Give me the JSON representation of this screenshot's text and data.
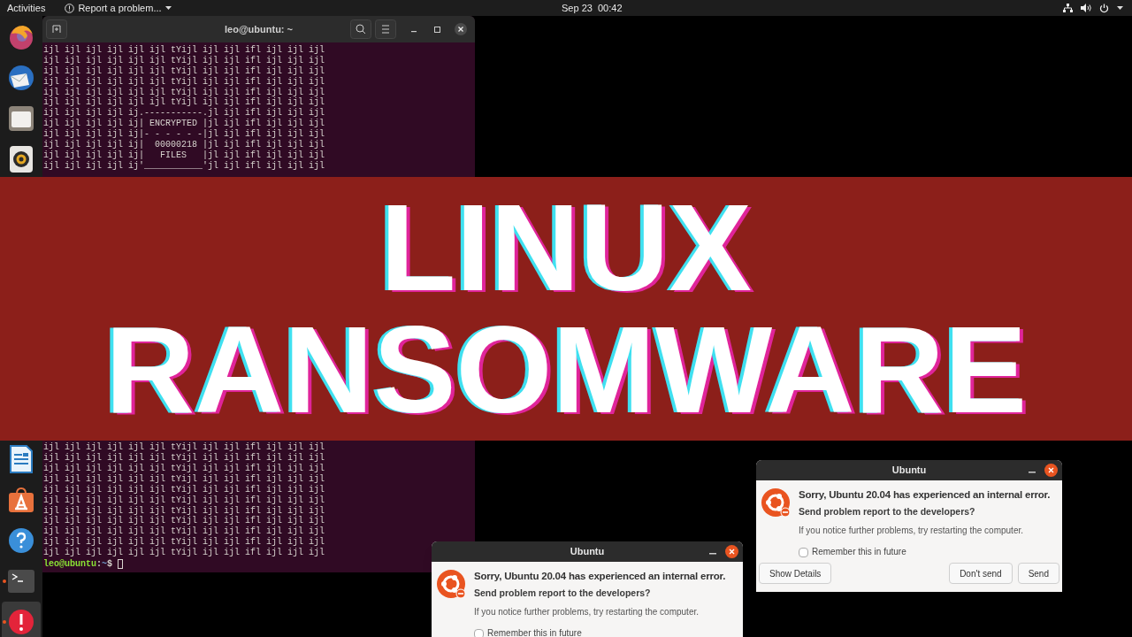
{
  "top_bar": {
    "activities": "Activities",
    "app_menu": "Report a problem...",
    "clock": "Sep 23  00:42"
  },
  "dock": {
    "items_top": [
      {
        "kind": "firefox",
        "running": false,
        "selected": false
      },
      {
        "kind": "mail",
        "running": false,
        "selected": false
      },
      {
        "kind": "files",
        "running": false,
        "selected": false
      },
      {
        "kind": "music",
        "running": false,
        "selected": false
      }
    ],
    "items_bottom": [
      {
        "kind": "writer",
        "running": false,
        "selected": false
      },
      {
        "kind": "store",
        "running": false,
        "selected": false
      },
      {
        "kind": "help",
        "running": false,
        "selected": false
      },
      {
        "kind": "terminal",
        "running": true,
        "selected": false
      },
      {
        "kind": "error",
        "running": true,
        "selected": true
      }
    ]
  },
  "terminal": {
    "title": "leo@ubuntu: ~",
    "lines_top": [
      "ijl ijl ijl ijl ijl ijl tYijl ijl ijl ifl ijl ijl ijl",
      "ijl ijl ijl ijl ijl ijl tYijl ijl ijl ifl ijl ijl ijl",
      "ijl ijl ijl ijl ijl ijl tYijl ijl ijl ifl ijl ijl ijl",
      "ijl ijl ijl ijl ijl ijl tYijl ijl ijl ifl ijl ijl ijl",
      "ijl ijl ijl ijl ijl ijl tYijl ijl ijl ifl ijl ijl ijl",
      "ijl ijl ijl ijl ijl ijl tYijl ijl ijl ifl ijl ijl ijl",
      "ijl ijl ijl ijl ij.-----------.jl ijl ifl ijl ijl ijl",
      "ijl ijl ijl ijl ij| ENCRYPTED |jl ijl ifl ijl ijl ijl",
      "ijl ijl ijl ijl ij|- - - - - -|jl ijl ifl ijl ijl ijl",
      "ijl ijl ijl ijl ij|  00000218 |jl ijl ifl ijl ijl ijl",
      "ijl ijl ijl ijl ij|   FILES   |jl ijl ifl ijl ijl ijl",
      "ijl ijl ijl ijl ij'___________'jl ijl ifl ijl ijl ijl"
    ],
    "lines_bottom": [
      "ijl ijl ijl ijl ijl ijl tYijl ijl ijl ifl ijl ijl ijl",
      "ijl ijl ijl ijl ijl ijl tYijl ijl ijl ifl ijl ijl ijl",
      "ijl ijl ijl ijl ijl ijl tYijl ijl ijl ifl ijl ijl ijl",
      "ijl ijl ijl ijl ijl ijl tYijl ijl ijl ifl ijl ijl ijl",
      "ijl ijl ijl ijl ijl ijl tYijl ijl ijl ifl ijl ijl ijl",
      "ijl ijl ijl ijl ijl ijl tYijl ijl ijl ifl ijl ijl ijl",
      "ijl ijl ijl ijl ijl ijl tYijl ijl ijl ifl ijl ijl ijl",
      "ijl ijl ijl ijl ijl ijl tYijl ijl ijl ifl ijl ijl ijl",
      "ijl ijl ijl ijl ijl ijl tYijl ijl ijl ifl ijl ijl ijl",
      "ijl ijl ijl ijl ijl ijl tYijl ijl ijl ifl ijl ijl ijl",
      "ijl ijl ijl ijl ijl ijl tYijl ijl ijl ifl ijl ijl ijl"
    ],
    "prompt": {
      "user_host": "leo@ubuntu",
      "separator": ":",
      "path": "~",
      "symbol": "$"
    }
  },
  "banner": {
    "lines": [
      "LINUX",
      "RANSOMWARE"
    ]
  },
  "dialogs": [
    {
      "title": "Ubuntu",
      "heading": "Sorry, Ubuntu 20.04 has experienced an internal error.",
      "question": "Send problem report to the developers?",
      "hint": "If you notice further problems, try restarting the computer.",
      "remember": {
        "label": "Remember this in future",
        "checked": false
      },
      "buttons": [
        "Show Details",
        "Don't send",
        "Send"
      ]
    },
    {
      "title": "Ubuntu",
      "heading": "Sorry, Ubuntu 20.04 has experienced an internal error.",
      "question": "Send problem report to the developers?",
      "hint": "If you notice further problems, try restarting the computer.",
      "remember": {
        "label": "Remember this in future",
        "checked": false
      }
    }
  ]
}
